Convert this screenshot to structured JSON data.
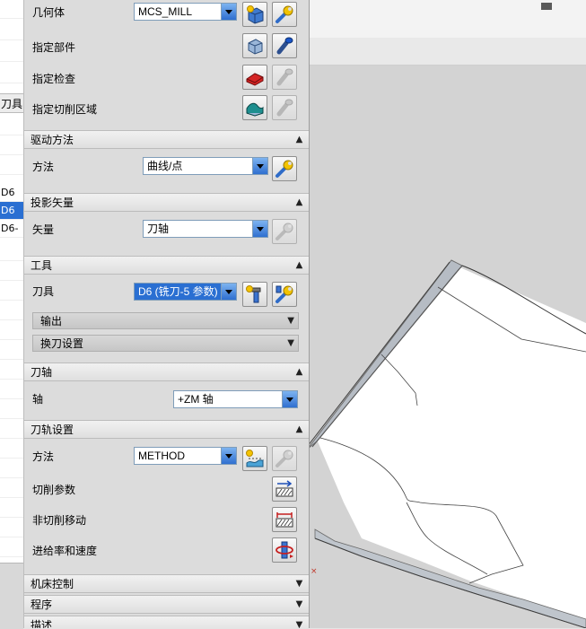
{
  "background_list": {
    "header_label": "刀具",
    "rows": [
      "D6",
      "D6",
      "D6-"
    ],
    "selected_index": 1
  },
  "dialog": {
    "geometry": {
      "label": "几何体",
      "combo_value": "MCS_MILL",
      "specify_part": "指定部件",
      "specify_check": "指定检查",
      "specify_cut_area": "指定切削区域"
    },
    "drive_method": {
      "header": "驱动方法",
      "method_label": "方法",
      "method_value": "曲线/点"
    },
    "projection_vector": {
      "header": "投影矢量",
      "vector_label": "矢量",
      "vector_value": "刀轴"
    },
    "tool": {
      "header": "工具",
      "tool_label": "刀具",
      "tool_value": "D6 (铣刀-5 参数)",
      "output_label": "输出",
      "tool_change_label": "换刀设置"
    },
    "tool_axis": {
      "header": "刀轴",
      "axis_label": "轴",
      "axis_value": "+ZM 轴"
    },
    "path_settings": {
      "header": "刀轨设置",
      "method_label": "方法",
      "method_value": "METHOD",
      "cut_params": "切削参数",
      "non_cut_moves": "非切削移动",
      "feeds_speeds": "进给率和速度"
    },
    "machine_control": {
      "header": "机床控制"
    },
    "program": {
      "header": "程序"
    },
    "description": {
      "header": "描述"
    }
  },
  "icons": {
    "chevron_up": "▲",
    "chevron_down": "▼"
  },
  "colors": {
    "highlight": "#2a6fd2",
    "dialog_bg": "#dcdcdc",
    "check_red": "#d42424",
    "cut_area_teal": "#1e8f8f"
  }
}
